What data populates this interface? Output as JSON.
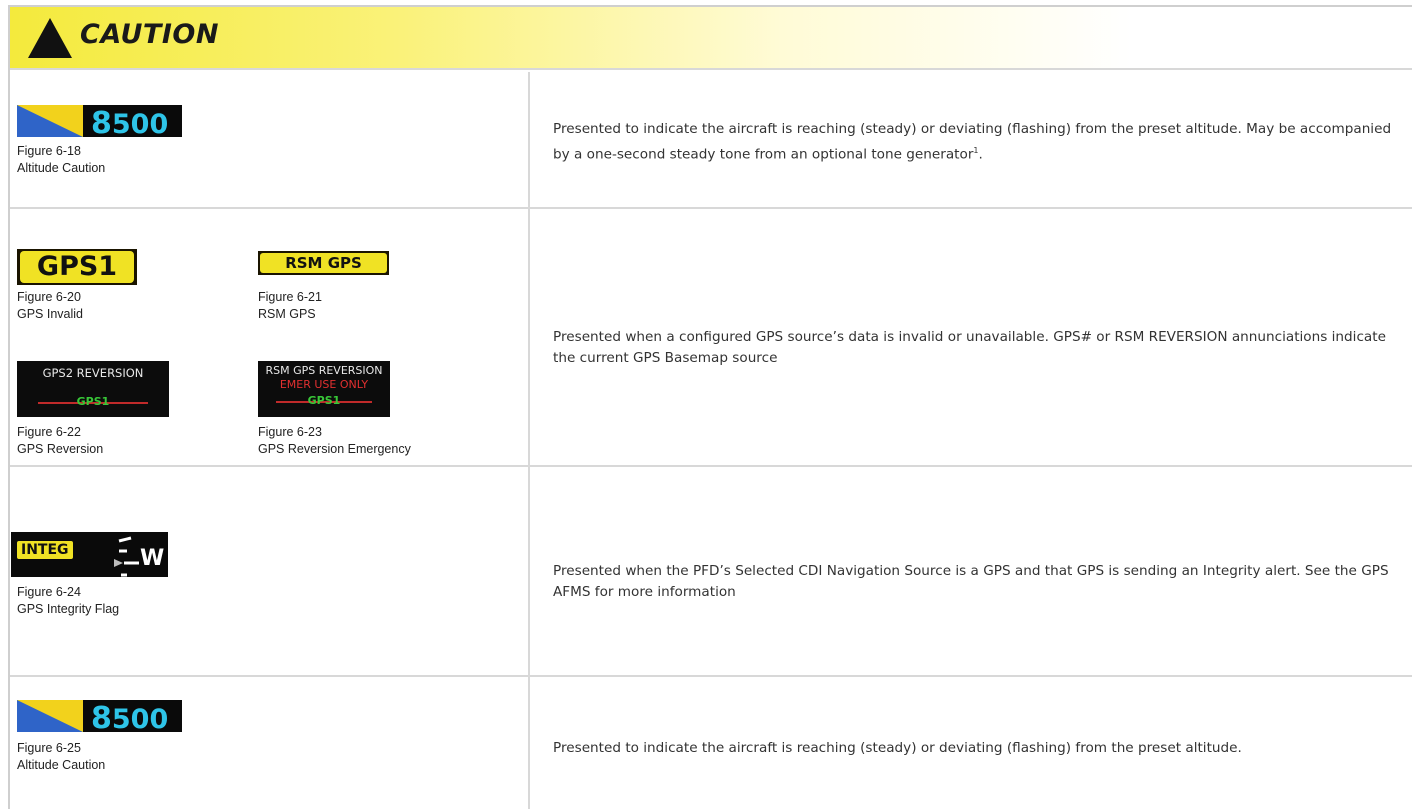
{
  "banner": {
    "title": "CAUTION",
    "icon": "warning-triangle-icon",
    "color": "#f4ea3c"
  },
  "rows": [
    {
      "figures": [
        {
          "number": "Figure 6-18",
          "caption": "Altitude Caution",
          "widget": {
            "thousands": "8",
            "hundreds": "500"
          }
        }
      ],
      "description": "Presented to indicate the aircraft is reaching (steady) or deviating (flashing) from the preset altitude. May be accompanied by a one-second steady tone from an optional tone generator",
      "footnote": "1"
    },
    {
      "figures": [
        {
          "number": "Figure 6-20",
          "caption": "GPS Invalid",
          "widget": {
            "label": "GPS1"
          }
        },
        {
          "number": "Figure 6-21",
          "caption": "RSM GPS",
          "widget": {
            "label": "RSM GPS"
          }
        },
        {
          "number": "Figure 6-22",
          "caption": "GPS Reversion",
          "widget": {
            "line1": "GPS2 REVERSION",
            "source": "GPS1"
          }
        },
        {
          "number": "Figure 6-23",
          "caption": "GPS Reversion Emergency",
          "widget": {
            "line1": "RSM GPS REVERSION",
            "line2": "EMER USE ONLY",
            "source": "GPS1"
          }
        }
      ],
      "description": "Presented when a configured GPS source’s data is invalid or unavailable. GPS# or RSM REVERSION annunciations indicate the current GPS Basemap source"
    },
    {
      "figures": [
        {
          "number": "Figure 6-24",
          "caption": "GPS Integrity Flag",
          "widget": {
            "label": "INTEG",
            "heading": "W"
          }
        }
      ],
      "description": "Presented when the PFD’s Selected CDI Navigation Source is a GPS and that GPS is sending an Integrity alert. See the GPS AFMS for more information"
    },
    {
      "figures": [
        {
          "number": "Figure 6-25",
          "caption": "Altitude Caution",
          "widget": {
            "thousands": "8",
            "hundreds": "500"
          }
        }
      ],
      "description": "Presented to indicate the aircraft is reaching (steady) or deviating (flashing) from the preset altitude."
    }
  ]
}
